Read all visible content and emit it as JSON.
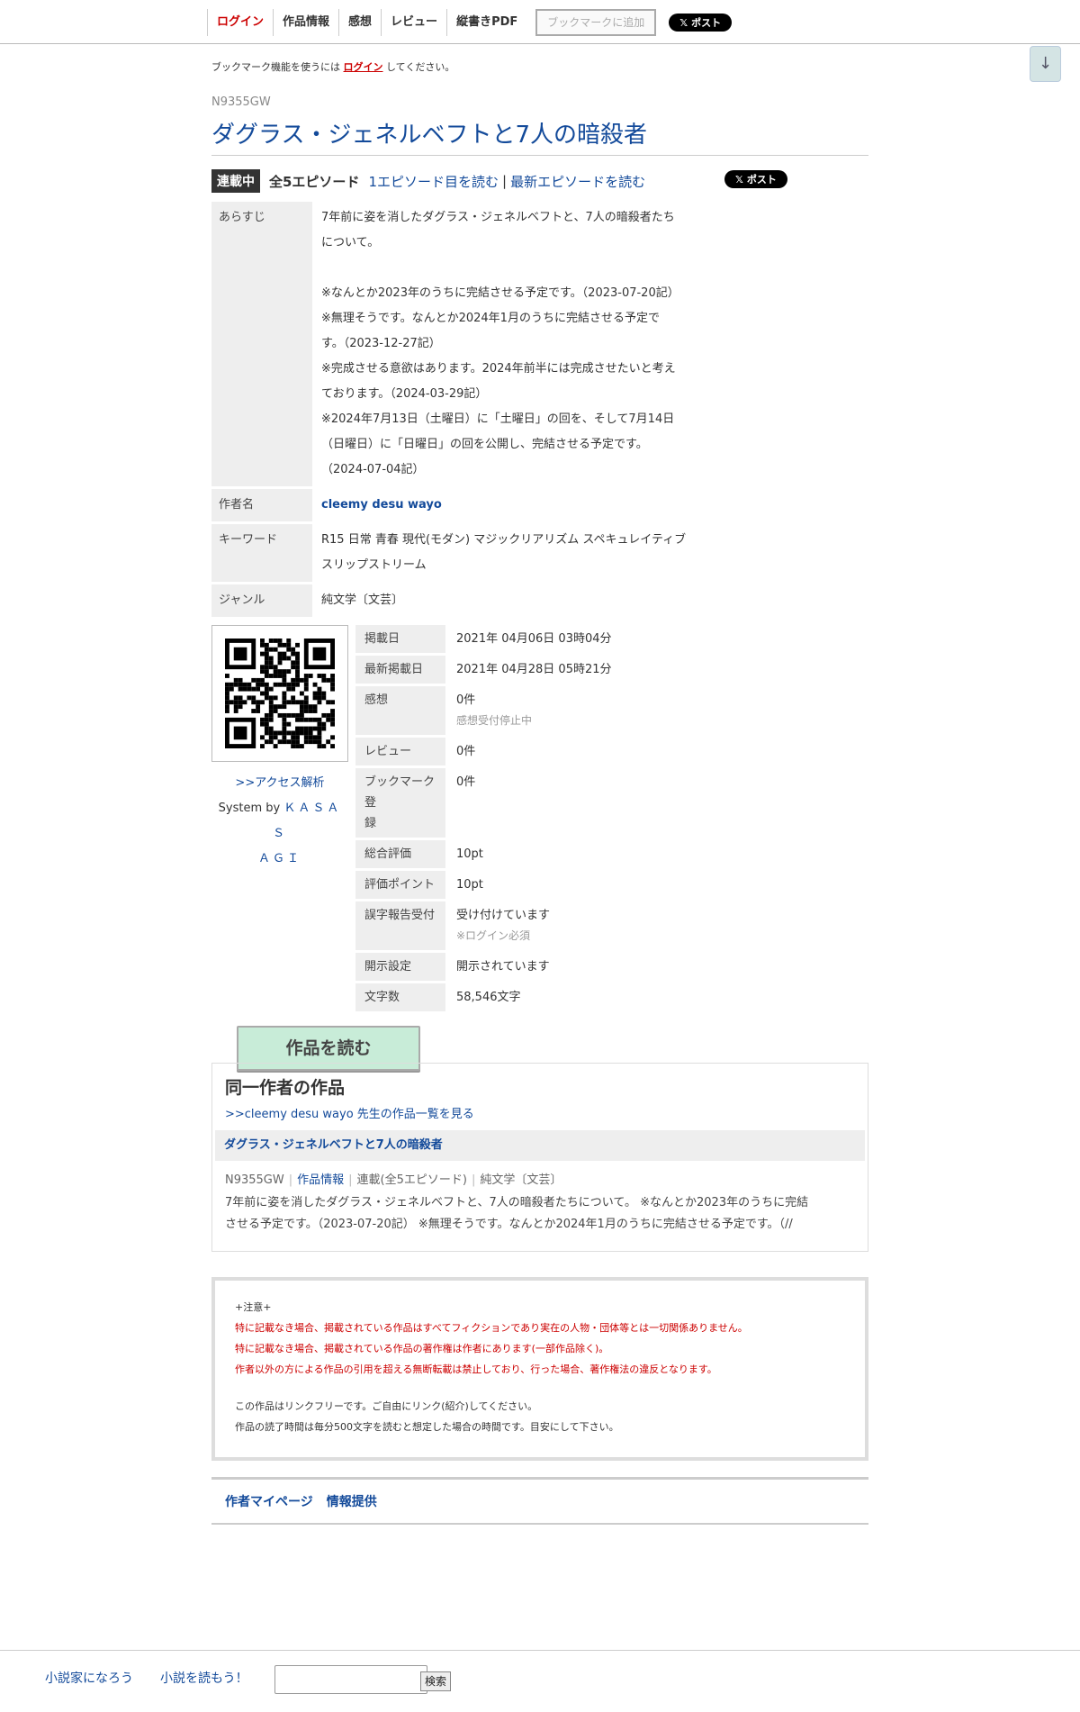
{
  "nav": {
    "login": "ログイン",
    "work_info": "作品情報",
    "impressions": "感想",
    "review": "レビュー",
    "pdf": "縦書きPDF",
    "bookmark_add": "ブックマークに追加",
    "post": "ポスト"
  },
  "scroll_button": "↓",
  "bookmark_note": {
    "prefix": "ブックマーク機能を使うには",
    "link": "ログイン",
    "suffix": "してください。"
  },
  "work": {
    "ncode": "N9355GW",
    "title": "ダグラス・ジェネルベフトと7人の暗殺者",
    "status": "連載中",
    "total": "全5エピソード",
    "first_episode": "1エピソード目を読む",
    "separator": "|",
    "latest_episode": "最新エピソードを読む",
    "post": "ポスト"
  },
  "info": {
    "synopsis_label": "あらすじ",
    "synopsis_lines": [
      "7年前に姿を消したダグラス・ジェネルベフトと、7人の暗殺者たち",
      "について。",
      "",
      "※なんとか2023年のうちに完結させる予定です。（2023-07-20記）",
      "※無理そうです。なんとか2024年1月のうちに完結させる予定で",
      "す。（2023-12-27記）",
      "※完成させる意欲はあります。2024年前半には完成させたいと考え",
      "ております。（2024-03-29記）",
      "※2024年7月13日（土曜日）に「土曜日」の回を、そして7月14日",
      "（日曜日）に「日曜日」の回を公開し、完結させる予定です。",
      "（2024-07-04記）"
    ],
    "author_label": "作者名",
    "author": "cleemy desu wayo",
    "keyword_label": "キーワード",
    "keywords_line1": "R15 日常 青春 現代(モダン) マジックリアリズム スペキュレイティブ",
    "keywords_line2": "スリップストリーム",
    "genre_label": "ジャンル",
    "genre": "純文学〔文芸〕"
  },
  "access": {
    "link": ">>アクセス解析",
    "system_prefix": "System by",
    "system_name1": "ＫＡＳＡＳ",
    "system_name2": "ＡＧＩ"
  },
  "stats": [
    {
      "label": "掲載日",
      "value": "2021年 04月06日 03時04分"
    },
    {
      "label": "最新掲載日",
      "value": "2021年 04月28日 05時21分"
    },
    {
      "label": "感想",
      "value": "0件",
      "sub": "感想受付停止中"
    },
    {
      "label": "レビュー",
      "value": "0件"
    },
    {
      "label": "ブックマーク登",
      "label2": "録",
      "value": "0件"
    },
    {
      "label": "総合評価",
      "value": "10pt"
    },
    {
      "label": "評価ポイント",
      "value": "10pt"
    },
    {
      "label": "誤字報告受付",
      "value": "受け付けています",
      "sub": "※ログイン必須"
    },
    {
      "label": "開示設定",
      "value": "開示されています"
    },
    {
      "label": "文字数",
      "value": "58,546文字"
    }
  ],
  "read_button": "作品を読む",
  "same_author": {
    "heading": "同一作者の作品",
    "more_link": ">>cleemy desu wayo 先生の作品一覧を見る",
    "work_title": "ダグラス・ジェネルベフトと7人の暗殺者",
    "meta_ncode": "N9355GW",
    "meta_info": "作品情報",
    "meta_serial": "連載(全5エピソード)",
    "meta_genre": "純文学〔文芸〕",
    "desc_line1": "7年前に姿を消したダグラス・ジェネルベフトと、7人の暗殺者たちについて。 ※なんとか2023年のうちに完結",
    "desc_line2": "させる予定です。（2023-07-20記） ※無理そうです。なんとか2024年1月のうちに完結させる予定です。（//"
  },
  "notice": {
    "head": "+注意+",
    "red1": "特に記載なき場合、掲載されている作品はすべてフィクションであり実在の人物・団体等とは一切関係ありません。",
    "red2": "特に記載なき場合、掲載されている作品の著作権は作者にあります(一部作品除く)。",
    "red3": "作者以外の方による作品の引用を超える無断転載は禁止しており、行った場合、著作権法の違反となります。",
    "line1": "この作品はリンクフリーです。ご自由にリンク(紹介)してください。",
    "line2": "作品の読了時間は毎分500文字を読むと想定した場合の時間です。目安にして下さい。"
  },
  "footer_links": {
    "mypage": "作者マイページ",
    "report": "情報提供"
  },
  "bottom": {
    "site1": "小説家になろう",
    "site2": "小説を読もう！",
    "search_value": "",
    "search_button": "検索"
  },
  "colors": {
    "link": "#134a9a",
    "accent_red": "#cc0000",
    "read_button": "#c8ecd8"
  }
}
